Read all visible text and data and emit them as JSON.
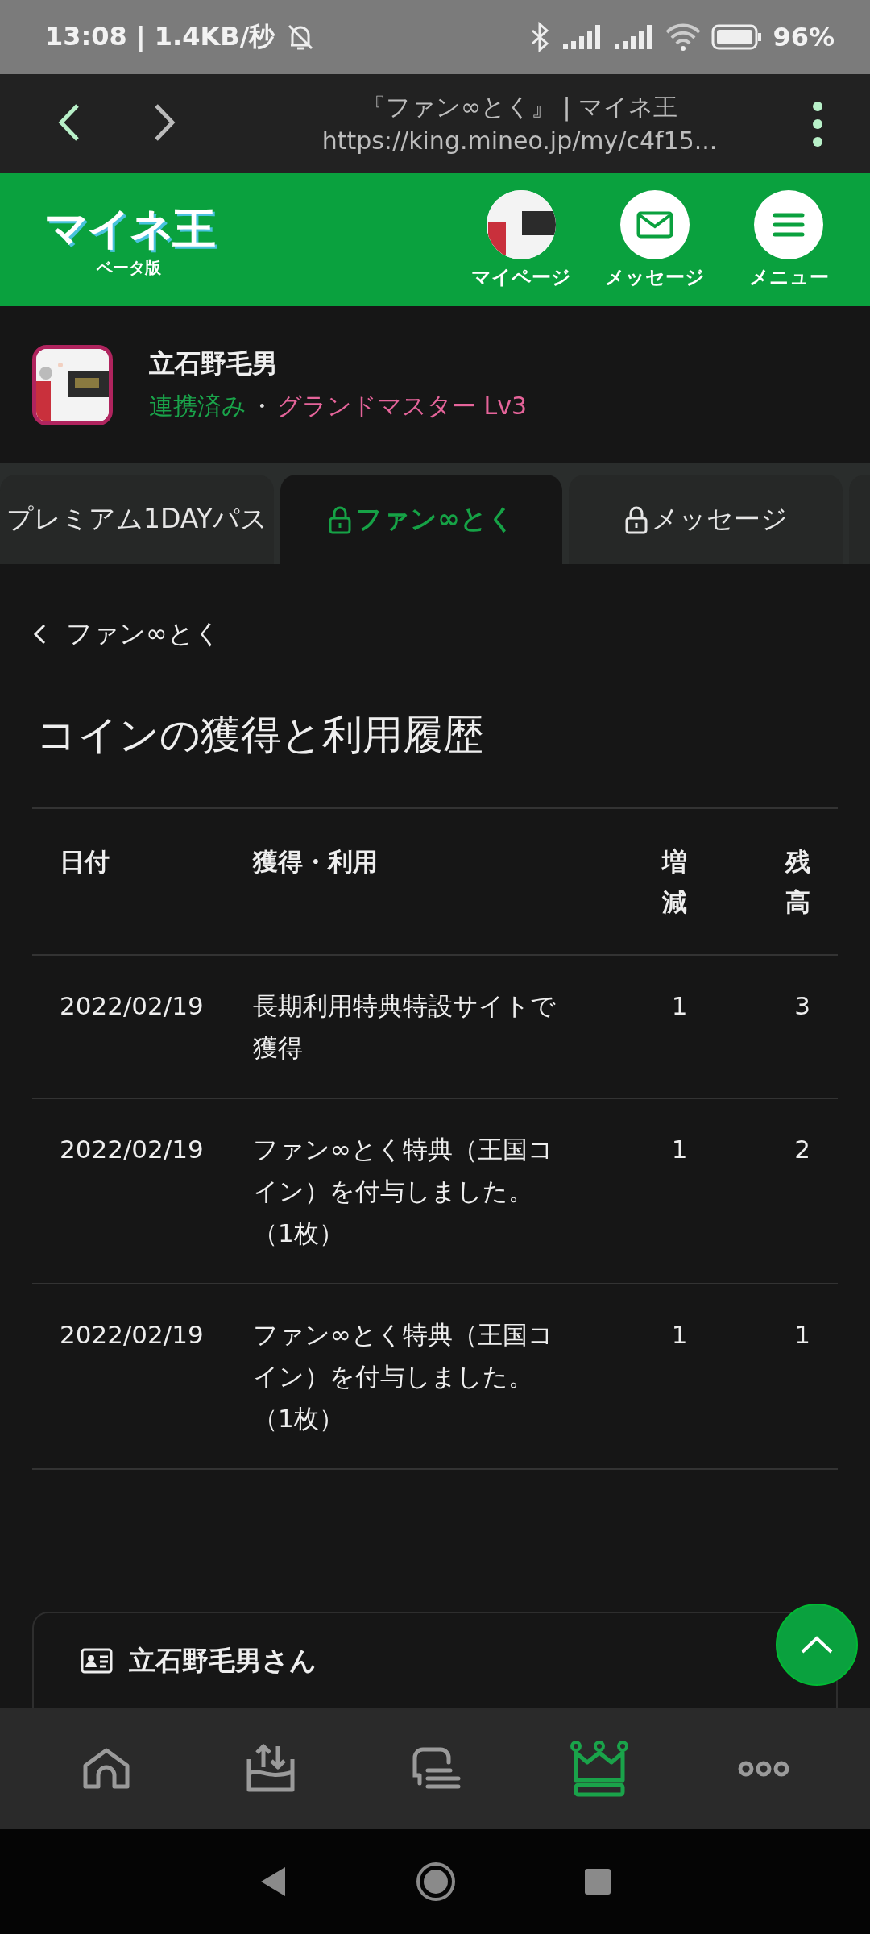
{
  "status_bar": {
    "time": "13:08 | 1.4KB/秒",
    "battery": "96%"
  },
  "browser": {
    "title": "『ファン∞とく』 | マイネ王",
    "url": "https://king.mineo.jp/my/c4f15..."
  },
  "header": {
    "logo": "マイネ王",
    "logo_sub": "ベータ版",
    "actions": [
      {
        "label": "マイページ",
        "kind": "avatar"
      },
      {
        "label": "メッセージ",
        "kind": "mail"
      },
      {
        "label": "メニュー",
        "kind": "menu"
      }
    ]
  },
  "profile": {
    "name": "立石野毛男",
    "link_status": "連携済み",
    "separator": "・",
    "rank": "グランドマスター Lv3"
  },
  "tabs": [
    {
      "label": "プレミアム1DAYパス",
      "locked": false,
      "selected": false
    },
    {
      "label": "ファン∞とく",
      "locked": true,
      "selected": true
    },
    {
      "label": "メッセージ",
      "locked": true,
      "selected": false
    }
  ],
  "back_link": "ファン∞とく",
  "page_title": "コインの獲得と利用履歴",
  "table": {
    "columns": [
      "日付",
      "獲得・利用",
      "増減",
      "残高"
    ],
    "rows": [
      [
        "2022/02/19",
        "長期利用特典特設サイトで獲得",
        "1",
        "3"
      ],
      [
        "2022/02/19",
        "ファン∞とく特典（王国コイン）を付与しました。（1枚）",
        "1",
        "2"
      ],
      [
        "2022/02/19",
        "ファン∞とく特典（王国コイン）を付与しました。（1枚）",
        "1",
        "1"
      ]
    ]
  },
  "card": {
    "title": "立石野毛男さん"
  },
  "bottom_nav": [
    {
      "kind": "home",
      "selected": false
    },
    {
      "kind": "transfer",
      "selected": false
    },
    {
      "kind": "chat",
      "selected": false
    },
    {
      "kind": "crown",
      "selected": true
    },
    {
      "kind": "more",
      "selected": false
    }
  ]
}
